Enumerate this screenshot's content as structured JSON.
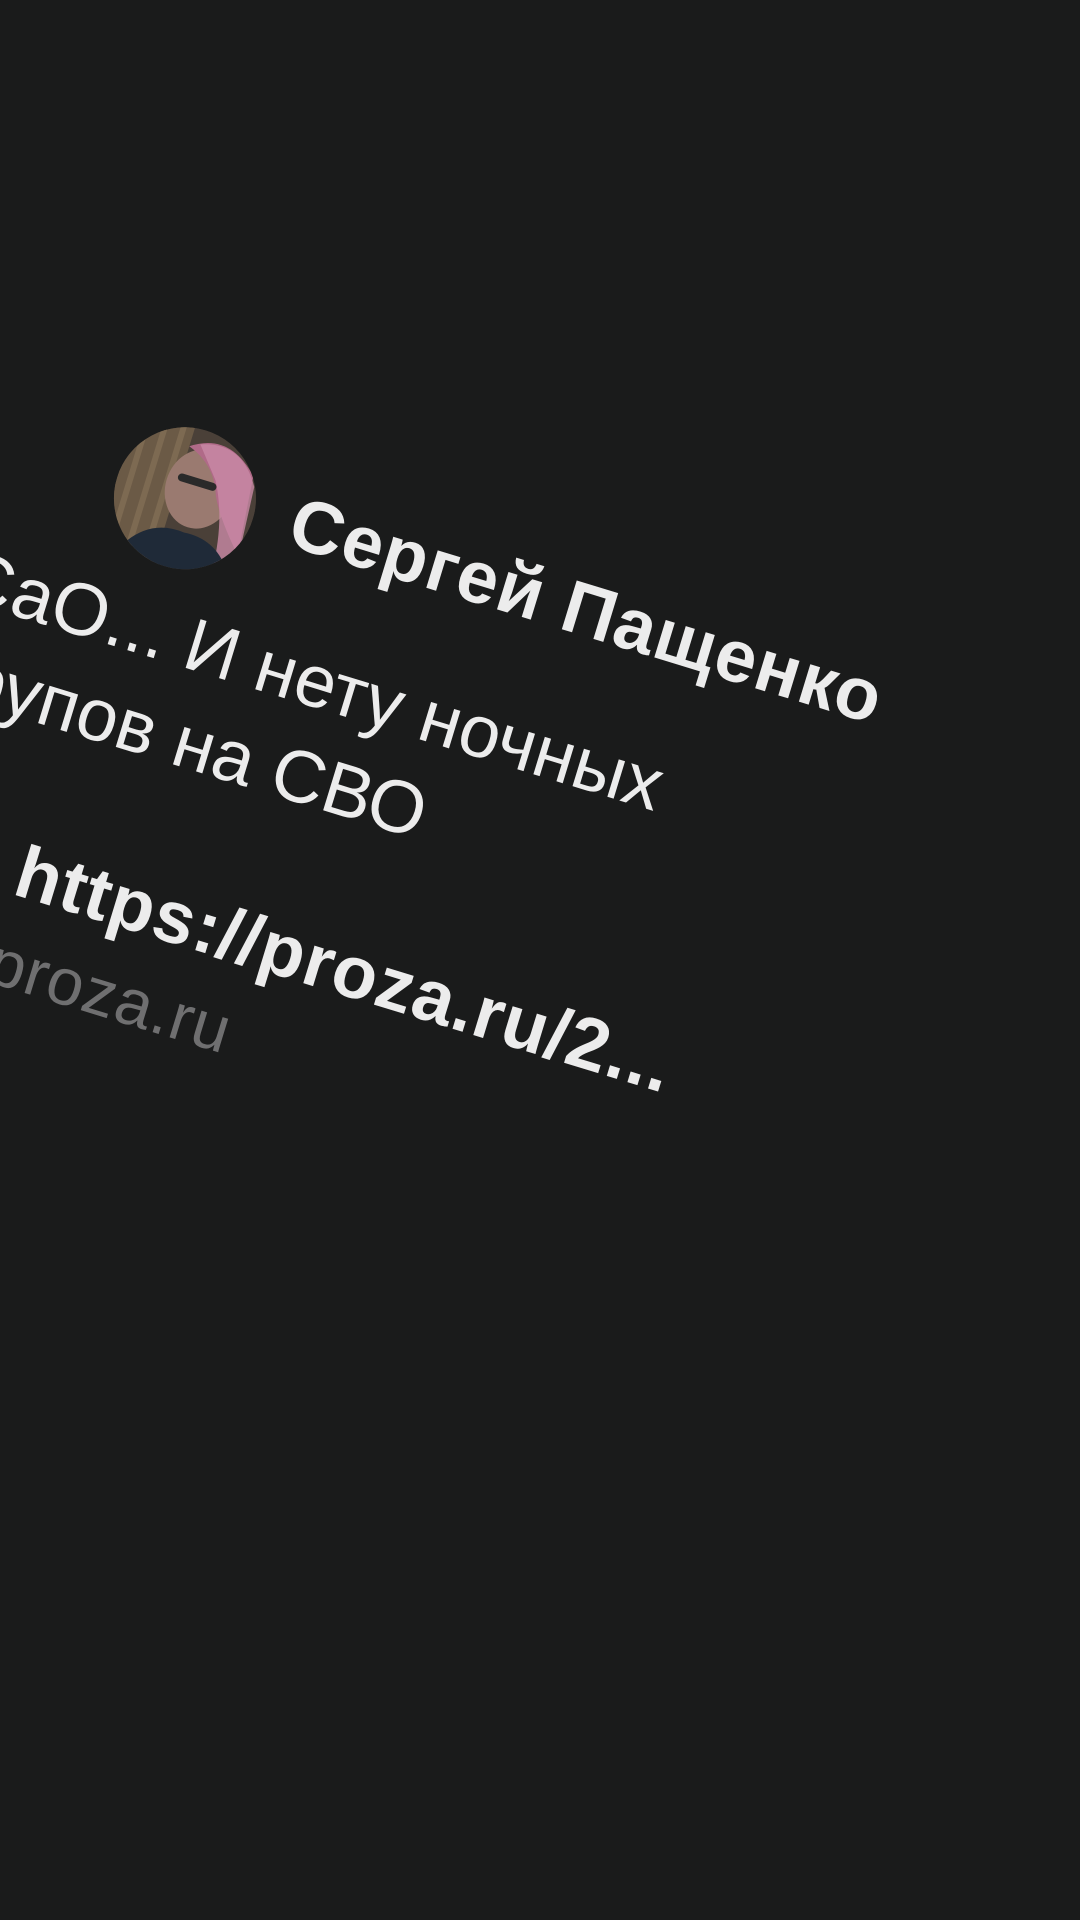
{
  "post": {
    "author_name": "Сергей Пащенко",
    "message": "СаО... И нету ночных трупов на СВО",
    "link": {
      "url": "https://proza.ru/2...",
      "domain": "proza.ru",
      "icon": "external-link-arrow-icon"
    },
    "avatar_icon": "user-avatar"
  },
  "colors": {
    "background": "#1a1b1b",
    "text_primary": "#ececec",
    "text_secondary": "#6f6f70",
    "tile": "#262727"
  }
}
